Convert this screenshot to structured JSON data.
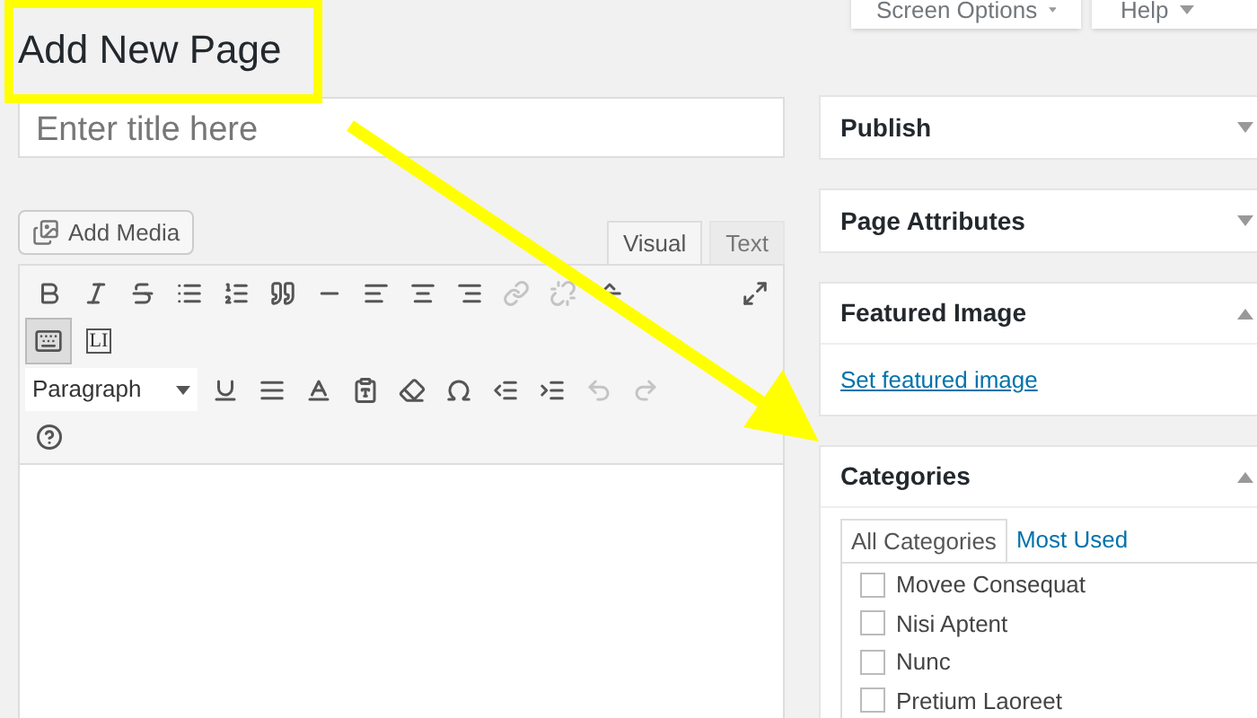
{
  "screen_meta": [
    {
      "label": "Screen Options"
    },
    {
      "label": "Help"
    }
  ],
  "heading": "Add New Page",
  "title_field": {
    "placeholder": "Enter title here"
  },
  "add_media": "Add Media",
  "editor_tabs": [
    {
      "label": "Visual",
      "selected": true
    },
    {
      "label": "Text",
      "selected": false
    }
  ],
  "toolbar_rows": [
    [
      {
        "disabled": false
      },
      {
        "disabled": false
      },
      {
        "disabled": false
      },
      {
        "disabled": false
      },
      {
        "disabled": false
      },
      {
        "disabled": false
      },
      {
        "disabled": false
      },
      {
        "disabled": false
      },
      {
        "disabled": false
      },
      {
        "disabled": false
      },
      {
        "disabled": true
      },
      {
        "disabled": true
      },
      {
        "disabled": false
      },
      {
        "disabled": false
      }
    ],
    [
      {
        "selected": true
      },
      {
        "selected": false,
        "label": "LI"
      }
    ],
    [
      {
        "disabled": false
      },
      {
        "disabled": false
      },
      {
        "disabled": false
      },
      {
        "disabled": false
      },
      {
        "disabled": false
      },
      {
        "disabled": false
      },
      {
        "disabled": false
      },
      {
        "disabled": false
      },
      {
        "disabled": true
      },
      {
        "disabled": true
      }
    ],
    [
      {
        "disabled": false
      }
    ]
  ],
  "format_select": "Paragraph",
  "boxes": [
    {
      "title": "Publish",
      "expanded": false
    },
    {
      "title": "Page Attributes",
      "expanded": false
    },
    {
      "title": "Featured Image",
      "expanded": true,
      "link": "Set featured image"
    },
    {
      "title": "Categories",
      "expanded": true
    }
  ],
  "category_tabs": [
    {
      "label": "All Categories",
      "selected": true
    },
    {
      "label": "Most Used",
      "selected": false
    }
  ],
  "categories": [
    {
      "name": "Movee Consequat",
      "checked": false
    },
    {
      "name": "Nisi Aptent",
      "checked": false
    },
    {
      "name": "Nunc",
      "checked": false
    },
    {
      "name": "Pretium Laoreet",
      "checked": false
    }
  ]
}
